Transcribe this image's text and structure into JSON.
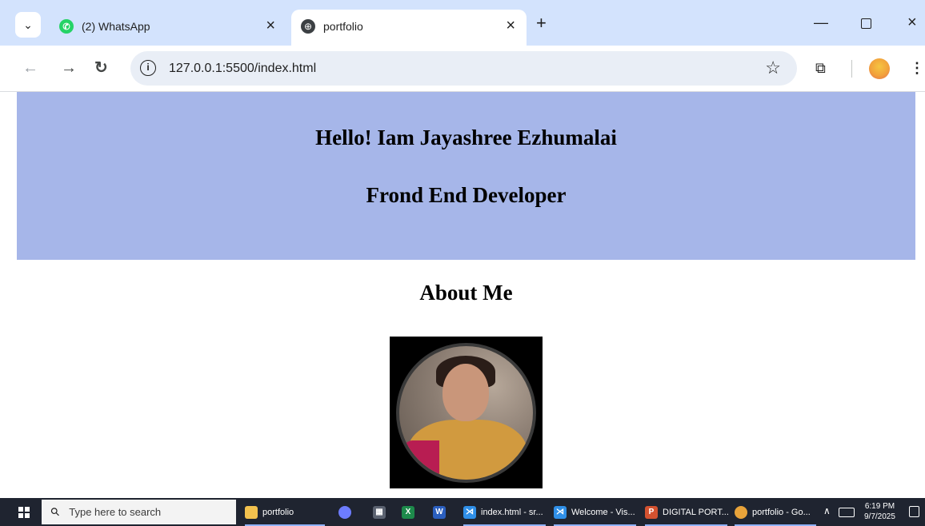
{
  "browser": {
    "tabs": [
      {
        "title": "(2) WhatsApp",
        "icon": "whatsapp-icon",
        "active": false
      },
      {
        "title": "portfolio",
        "icon": "globe-icon",
        "active": true
      }
    ],
    "address_bar": {
      "url": "127.0.0.1:5500/index.html"
    },
    "icons": {
      "tab_search": "chevron-down-icon",
      "tab_close": "close-icon",
      "new_tab": "plus-icon",
      "back": "arrow-left-icon",
      "forward": "arrow-right-icon",
      "reload": "reload-icon",
      "site_info": "info-icon",
      "bookmark": "star-icon",
      "extensions": "puzzle-icon",
      "menu": "kebab-icon"
    }
  },
  "page": {
    "hero": {
      "name_line": "Hello! Iam Jayashree Ezhumalai",
      "role_line": "Frond End Developer",
      "background": "#a6b6e9"
    },
    "about": {
      "title": "About Me",
      "photo": "profile-photo"
    }
  },
  "taskbar": {
    "search_placeholder": "Type here to search",
    "items": [
      {
        "label": "portfolio",
        "icon": "folder-icon",
        "color": "#f2c14e"
      },
      {
        "label": "",
        "icon": "copilot-icon",
        "color": "#6d7cff"
      },
      {
        "label": "",
        "icon": "calendar-icon",
        "color": "#5b6270"
      },
      {
        "label": "",
        "icon": "excel-icon",
        "color": "#1d8a4b"
      },
      {
        "label": "",
        "icon": "word-icon",
        "color": "#2b5fbf"
      },
      {
        "label": "index.html - sr...",
        "icon": "vscode-icon",
        "color": "#2f8fe8"
      },
      {
        "label": "Welcome - Vis...",
        "icon": "vscode-icon",
        "color": "#2f8fe8"
      },
      {
        "label": "DIGITAL PORT...",
        "icon": "powerpoint-icon",
        "color": "#d35230"
      },
      {
        "label": "portfolio - Go...",
        "icon": "chrome-icon",
        "color": "#e8a33a"
      }
    ],
    "clock": {
      "time": "6:19 PM",
      "date": "9/7/2025"
    }
  }
}
